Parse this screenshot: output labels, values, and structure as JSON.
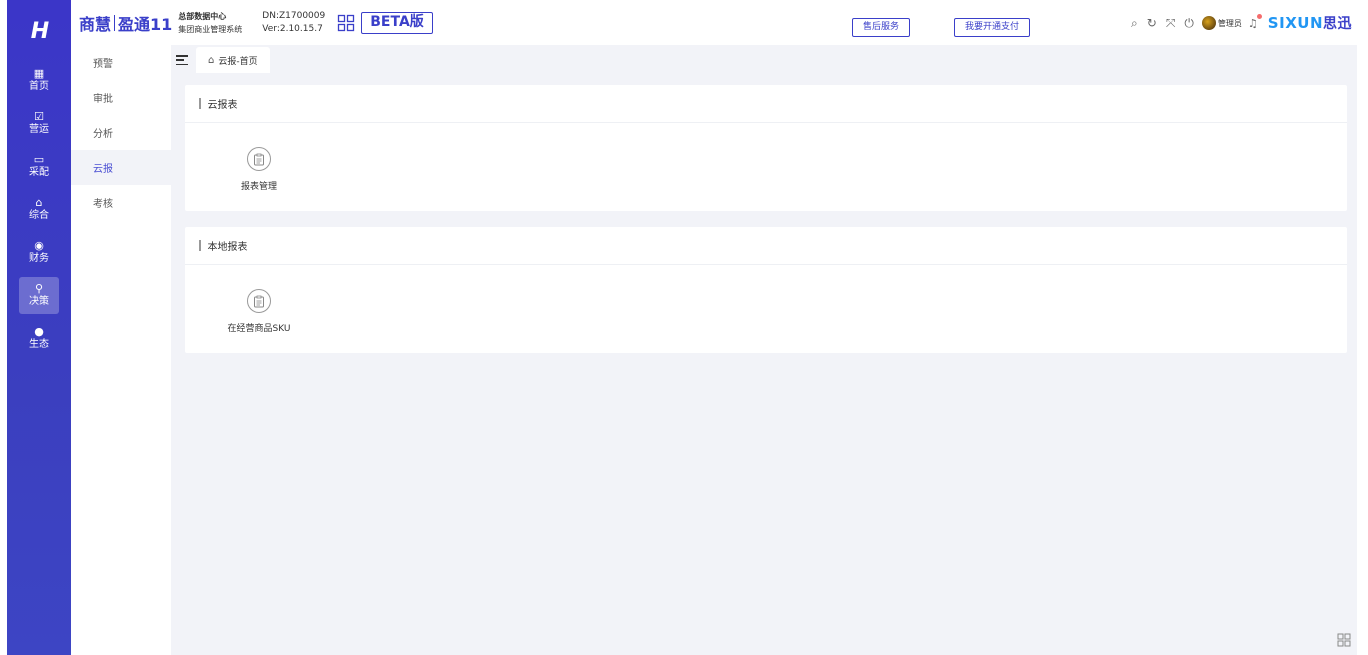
{
  "header": {
    "brand_a": "商慧",
    "brand_b": "盈通11",
    "org": "总部数据中心",
    "system": "集团商业管理系统",
    "dn": "DN:Z1700009",
    "version": "Ver:2.10.15.7",
    "beta": "BETA版",
    "after_sales": "售后服务",
    "open_payment": "我要开通支付",
    "user": "管理员",
    "logo_a": "SI",
    "logo_x": "X",
    "logo_b": "UN",
    "logo_cn": "思迅"
  },
  "rail": {
    "logo": "H",
    "items": [
      {
        "label": "首页",
        "icon": "dashboard-icon"
      },
      {
        "label": "营运",
        "icon": "chart-icon"
      },
      {
        "label": "采配",
        "icon": "truck-icon"
      },
      {
        "label": "综合",
        "icon": "bag-icon"
      },
      {
        "label": "财务",
        "icon": "coin-icon"
      },
      {
        "label": "决策",
        "icon": "decision-icon"
      },
      {
        "label": "生态",
        "icon": "eco-icon"
      }
    ]
  },
  "submenu": {
    "items": [
      "预警",
      "审批",
      "分析",
      "云报",
      "考核"
    ]
  },
  "tabs": {
    "current": "云报-首页"
  },
  "sections": [
    {
      "title": "云报表",
      "items": [
        "报表管理"
      ]
    },
    {
      "title": "本地报表",
      "items": [
        "在经营商品SKU"
      ]
    }
  ],
  "colors": {
    "rail_bg": "#3b3fbf",
    "accent": "#3a3fc9",
    "main_bg": "#f2f3f8"
  }
}
